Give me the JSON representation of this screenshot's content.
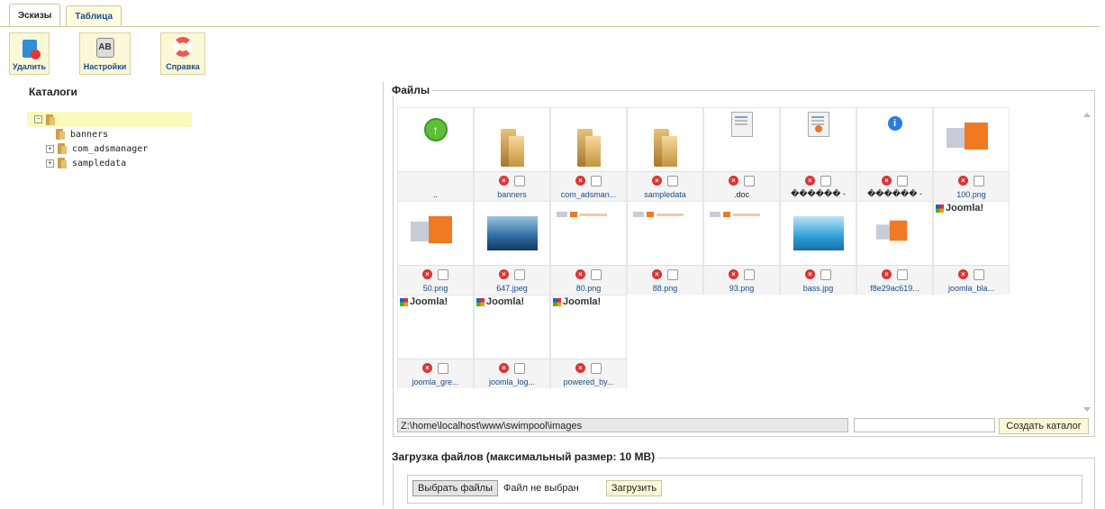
{
  "tabs": [
    "Эскизы",
    "Таблица"
  ],
  "toolbar": {
    "delete": "Удалить",
    "settings": "Настройки",
    "help": "Справка"
  },
  "left": {
    "title": "Каталоги",
    "tree": [
      "banners",
      "com_adsmanager",
      "sampledata"
    ]
  },
  "files": {
    "title": "Файлы",
    "items": [
      {
        "name": "..",
        "kind": "up"
      },
      {
        "name": "banners",
        "kind": "folder"
      },
      {
        "name": "com_adsman...",
        "kind": "folder"
      },
      {
        "name": "sampledata",
        "kind": "folder"
      },
      {
        "name": ".doc",
        "kind": "doc"
      },
      {
        "name": "������ -",
        "kind": "docpie"
      },
      {
        "name": "������ -",
        "kind": "info"
      },
      {
        "name": "100.png",
        "kind": "logo"
      },
      {
        "name": "50.png",
        "kind": "logo"
      },
      {
        "name": "647.jpeg",
        "kind": "pool"
      },
      {
        "name": "80.png",
        "kind": "mini"
      },
      {
        "name": "88.png",
        "kind": "mini"
      },
      {
        "name": "93.png",
        "kind": "mini"
      },
      {
        "name": "bass.jpg",
        "kind": "pool2"
      },
      {
        "name": "f8e29ac619...",
        "kind": "logosm"
      },
      {
        "name": "joomla_bla...",
        "kind": "joomla"
      },
      {
        "name": "joomla_gre...",
        "kind": "joomla"
      },
      {
        "name": "joomla_log...",
        "kind": "joomla"
      },
      {
        "name": "powered_by...",
        "kind": "joomla"
      }
    ],
    "joomla_text": "Joomla!",
    "path": "Z:\\home\\localhost\\www\\swimpool\\images",
    "create_dir": "Создать каталог"
  },
  "upload": {
    "title": "Загрузка файлов (максимальный размер: 10 MB)",
    "choose": "Выбрать файлы",
    "no_file": "Файл не выбран",
    "submit": "Загрузить"
  }
}
